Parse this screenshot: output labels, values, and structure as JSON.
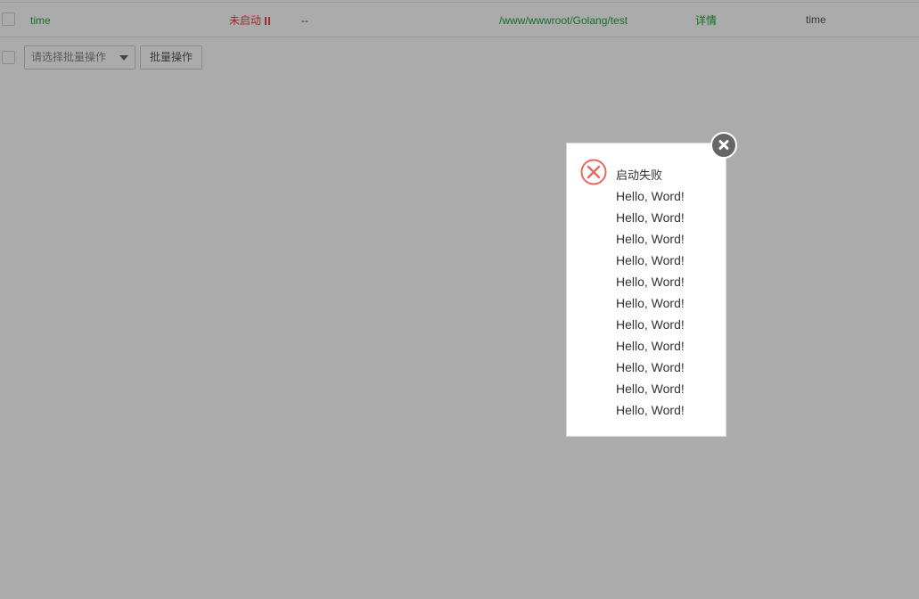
{
  "table": {
    "row": {
      "name": "time",
      "status": "未启动",
      "pid": "--",
      "path": "/www/wwwroot/Golang/test",
      "detail": "详情",
      "remark": "time"
    }
  },
  "batch": {
    "select_placeholder": "请选择批量操作",
    "button_label": "批量操作"
  },
  "dialog": {
    "icon": "error-circle-icon",
    "title": "启动失败",
    "lines": [
      "Hello, Word!",
      "Hello, Word!",
      "Hello, Word!",
      "Hello, Word!",
      "Hello, Word!",
      "Hello, Word!",
      "Hello, Word!",
      "Hello, Word!",
      "Hello, Word!",
      "Hello, Word!",
      "Hello, Word!"
    ]
  },
  "colors": {
    "accent_green": "#20a53a",
    "status_red": "#e04545",
    "overlay": "rgba(0,0,0,0.33)"
  }
}
